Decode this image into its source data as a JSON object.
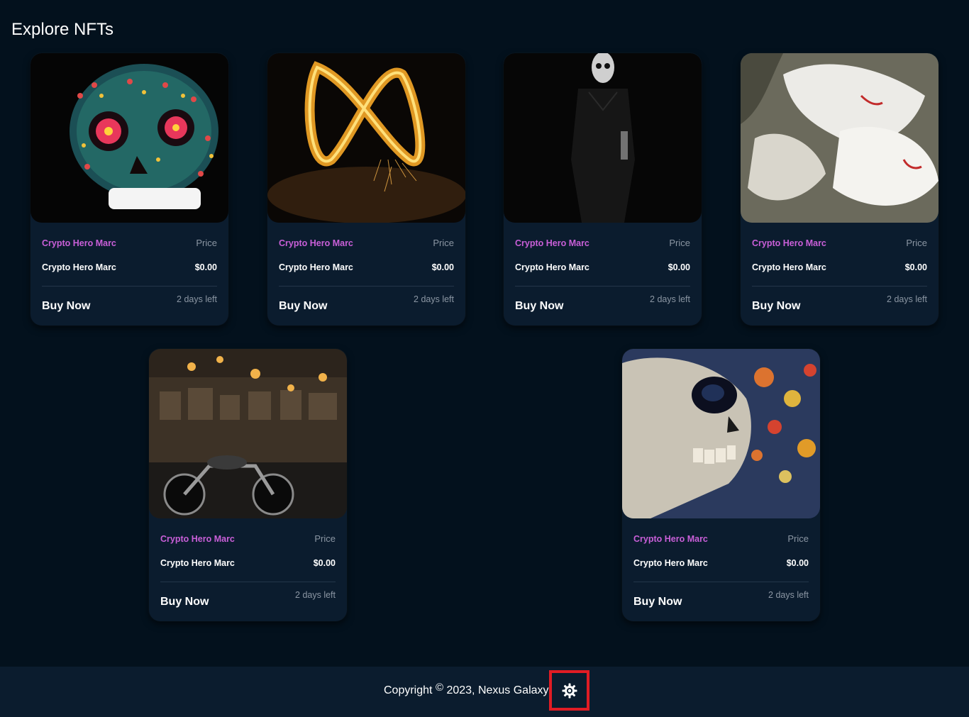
{
  "page": {
    "title": "Explore NFTs"
  },
  "cards": [
    {
      "collection": "Crypto Hero Marc",
      "price_label": "Price",
      "name": "Crypto Hero Marc",
      "price": "$0.00",
      "buy_label": "Buy Now",
      "time_left": "2 days left",
      "image": "sugar-skull-image"
    },
    {
      "collection": "Crypto Hero Marc",
      "price_label": "Price",
      "name": "Crypto Hero Marc",
      "price": "$0.00",
      "buy_label": "Buy Now",
      "time_left": "2 days left",
      "image": "fire-infinity-image"
    },
    {
      "collection": "Crypto Hero Marc",
      "price_label": "Price",
      "name": "Crypto Hero Marc",
      "price": "$0.00",
      "buy_label": "Buy Now",
      "time_left": "2 days left",
      "image": "dark-figure-image"
    },
    {
      "collection": "Crypto Hero Marc",
      "price_label": "Price",
      "name": "Crypto Hero Marc",
      "price": "$0.00",
      "buy_label": "Buy Now",
      "time_left": "2 days left",
      "image": "white-petals-image"
    },
    {
      "collection": "Crypto Hero Marc",
      "price_label": "Price",
      "name": "Crypto Hero Marc",
      "price": "$0.00",
      "buy_label": "Buy Now",
      "time_left": "2 days left",
      "image": "motorcycle-shop-image"
    },
    {
      "collection": "Crypto Hero Marc",
      "price_label": "Price",
      "name": "Crypto Hero Marc",
      "price": "$0.00",
      "buy_label": "Buy Now",
      "time_left": "2 days left",
      "image": "skull-bokeh-image"
    }
  ],
  "footer": {
    "copyright_prefix": "Copyright",
    "copyright_symbol": "©",
    "copyright_suffix": "2023, Nexus Galaxy",
    "theme_icon": "gear-icon",
    "highlight_color": "#e01c24"
  },
  "colors": {
    "background": "#03111d",
    "card": "#0b1c2e",
    "collection_accent": "#c95fd8",
    "muted_text": "#8b96a3"
  }
}
